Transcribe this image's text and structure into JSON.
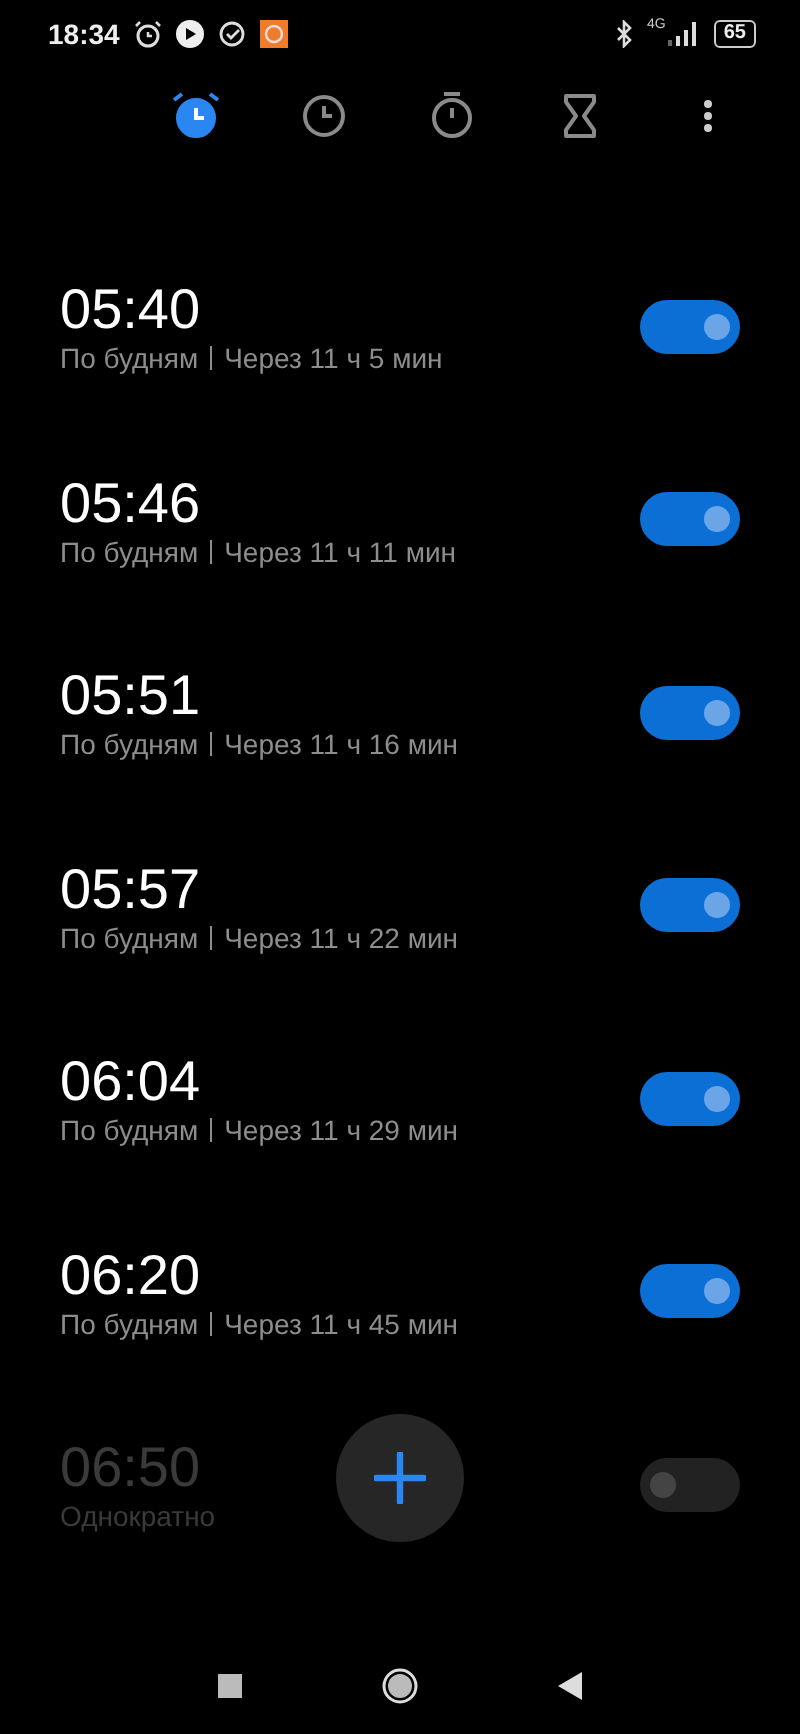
{
  "status_bar": {
    "time": "18:34",
    "network": "4G",
    "battery": "65"
  },
  "tabs": [
    {
      "kind": "alarm",
      "selected": true
    },
    {
      "kind": "clock",
      "selected": false
    },
    {
      "kind": "stopwatch",
      "selected": false
    },
    {
      "kind": "timer",
      "selected": false
    }
  ],
  "alarms": [
    {
      "time": "05:40",
      "label": "По будням",
      "countdown": "Через 11 ч 5 мин",
      "on": true
    },
    {
      "time": "05:46",
      "label": "По будням",
      "countdown": "Через 11 ч 11 мин",
      "on": true
    },
    {
      "time": "05:51",
      "label": "По будням",
      "countdown": "Через 11 ч 16 мин",
      "on": true
    },
    {
      "time": "05:57",
      "label": "По будням",
      "countdown": "Через 11 ч 22 мин",
      "on": true
    },
    {
      "time": "06:04",
      "label": "По будням",
      "countdown": "Через 11 ч 29 мин",
      "on": true
    },
    {
      "time": "06:20",
      "label": "По будням",
      "countdown": "Через 11 ч 45 мин",
      "on": true
    },
    {
      "time": "06:50",
      "label": "Однократно",
      "on": false
    }
  ]
}
